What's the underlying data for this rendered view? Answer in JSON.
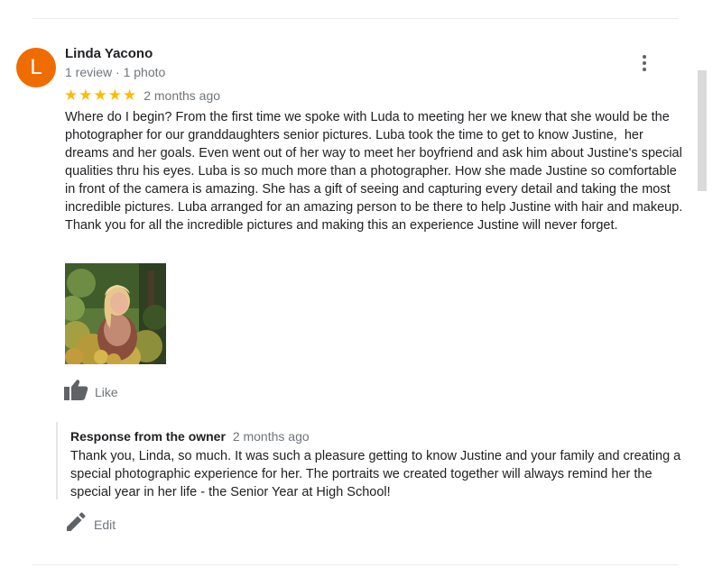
{
  "review": {
    "avatar_letter": "L",
    "avatar_color": "#ef6c00",
    "reviewer_name": "Linda Yacono",
    "reviewer_meta": "1 review · 1 photo",
    "rating": 5,
    "stars": "★★★★★",
    "star_color": "#fbbc04",
    "date": "2 months ago",
    "text": "Where do I begin? From the first time we spoke with Luda to meeting her we knew that she would be the photographer for our granddaughters senior pictures. Luba took the time to get to know Justine,  her dreams and her goals. Even went out of her way to meet her boyfriend and ask him about Justine's special qualities thru his eyes. Luba is so much more than a photographer. How she made Justine so comfortable in front of the camera is amazing. She has a gift of seeing and capturing every detail and taking the most incredible pictures. Luba arranged for an amazing person to be there to help Justine with hair and makeup.  Thank you for all the incredible pictures and making this an experience Justine will never forget.",
    "more_icon": "more-vertical-icon",
    "like_icon": "thumbs-up-icon",
    "like_label": "Like"
  },
  "owner_response": {
    "title": "Response from the owner",
    "date": "2 months ago",
    "text": "Thank you, Linda, so much. It was such a pleasure getting to know Justine and your family and creating a special photographic experience for her. The portraits we created together will always remind her the special year in her life - the Senior Year at High School!"
  },
  "actions": {
    "edit_icon": "pencil-icon",
    "edit_label": "Edit"
  }
}
